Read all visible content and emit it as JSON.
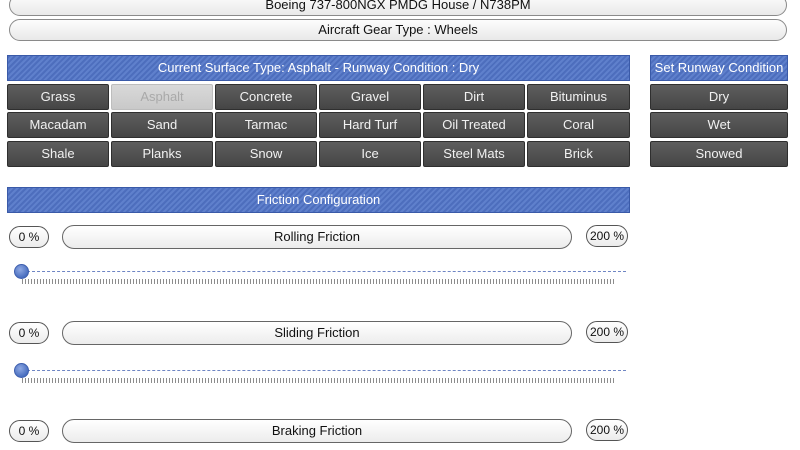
{
  "top": {
    "aircraft_title": "Boeing 737-800NGX PMDG House / N738PM",
    "gear_type": "Aircraft Gear Type : Wheels"
  },
  "surface": {
    "header": "Current Surface Type: Asphalt  -  Runway Condition : Dry",
    "selected": "Asphalt",
    "rows": [
      [
        "Grass",
        "Asphalt",
        "Concrete",
        "Gravel",
        "Dirt",
        "Bituminus"
      ],
      [
        "Macadam",
        "Sand",
        "Tarmac",
        "Hard Turf",
        "Oil Treated",
        "Coral"
      ],
      [
        "Shale",
        "Planks",
        "Snow",
        "Ice",
        "Steel Mats",
        "Brick"
      ]
    ]
  },
  "runway": {
    "header": "Set Runway Condition",
    "options": [
      "Dry",
      "Wet",
      "Snowed"
    ]
  },
  "friction": {
    "header": "Friction Configuration",
    "rows": [
      {
        "label": "Rolling Friction",
        "min": "0 %",
        "max": "200 %",
        "value_pct": 0
      },
      {
        "label": "Sliding Friction",
        "min": "0 %",
        "max": "200 %",
        "value_pct": 0
      },
      {
        "label": "Braking Friction",
        "min": "0 %",
        "max": "200 %"
      }
    ]
  },
  "colors": {
    "header_blue": "#4d6ebd",
    "button_dark": "#4f4f4f",
    "slider_thumb": "#4a6fc0"
  }
}
